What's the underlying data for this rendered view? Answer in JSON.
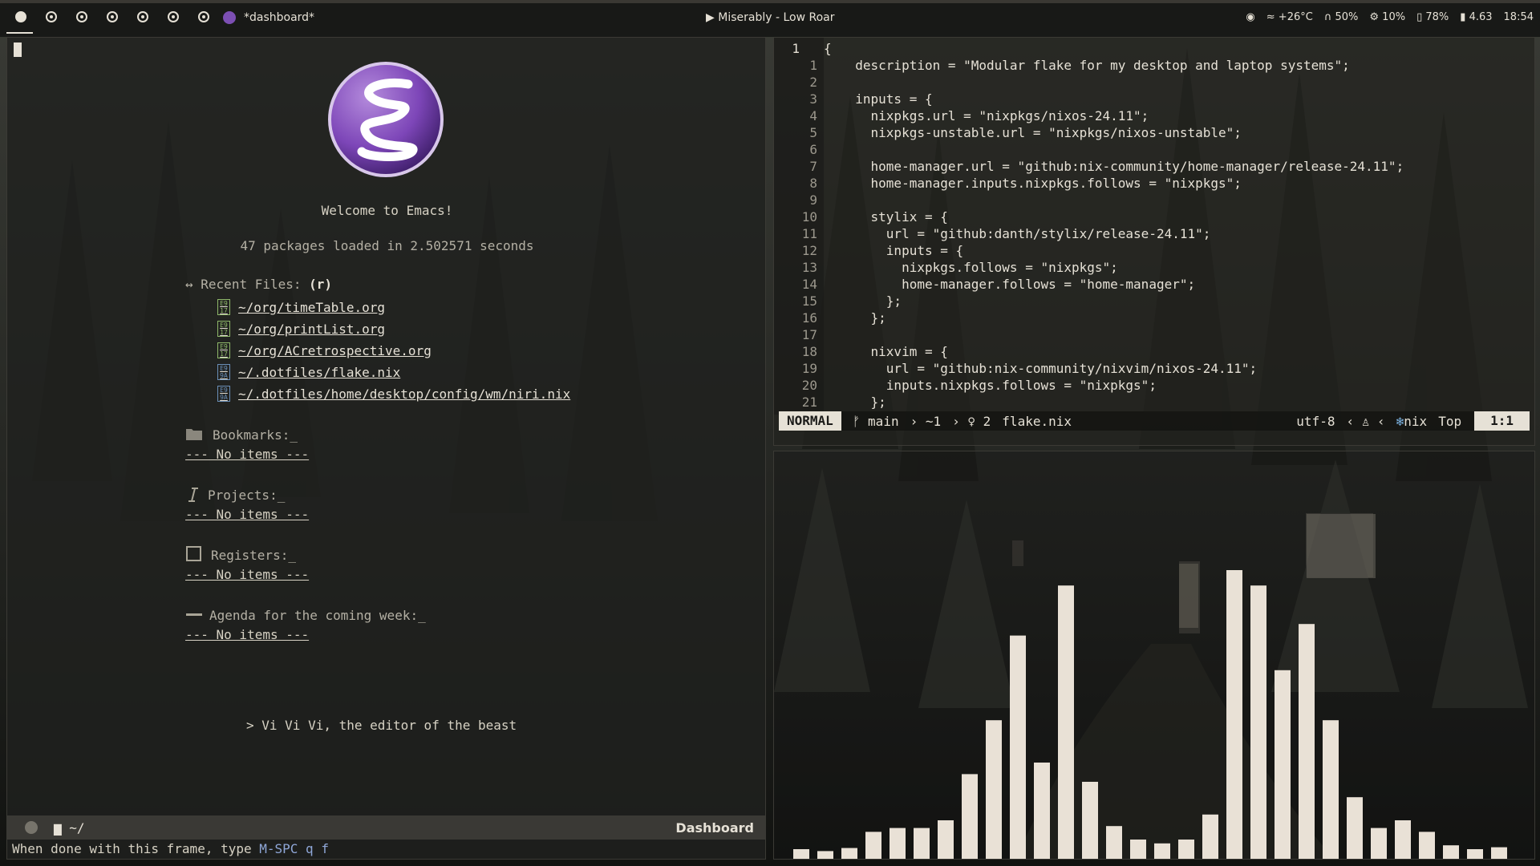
{
  "topbar": {
    "workspaces": [
      {
        "id": 1,
        "active": true
      },
      {
        "id": 2,
        "active": false
      },
      {
        "id": 3,
        "active": false
      },
      {
        "id": 4,
        "active": false
      },
      {
        "id": 5,
        "active": false
      },
      {
        "id": 6,
        "active": false
      },
      {
        "id": 7,
        "active": false
      }
    ],
    "window_title": "*dashboard*",
    "media_icon": "play-icon",
    "media_text": "Miserably - Low Roar",
    "status": {
      "steam_icon": "steam-icon",
      "temperature": "+26°C",
      "headphones": "50%",
      "cpu": "10%",
      "memory": "78%",
      "load": "4.63",
      "clock": "18:54"
    }
  },
  "dashboard": {
    "welcome": "Welcome to Emacs!",
    "packages": "47 packages loaded in 2.502571 seconds",
    "recent_files_label": "Recent Files:",
    "recent_files_key": "(r)",
    "recent_files": [
      {
        "icon_text": "E9\n17",
        "path": "~/org/timeTable.org"
      },
      {
        "icon_text": "E9\n17",
        "path": "~/org/printList.org"
      },
      {
        "icon_text": "E9\n17",
        "path": "~/org/ACretrospective.org"
      },
      {
        "icon_text": "E9\n9A",
        "path": "~/.dotfiles/flake.nix"
      },
      {
        "icon_text": "E9\n9A",
        "path": "~/.dotfiles/home/desktop/config/wm/niri.nix"
      }
    ],
    "bookmarks_label": "Bookmarks:_",
    "projects_label": "Projects:_",
    "registers_label": "Registers:_",
    "agenda_label": "Agenda for the coming week:_",
    "no_items": "--- No items ---",
    "quote": "> Vi Vi Vi, the editor of the beast",
    "modeline": {
      "dir": "~/",
      "buffer": "Dashboard"
    },
    "minibuffer_text": "When done with this frame, type ",
    "minibuffer_key": "M-SPC q f"
  },
  "editor": {
    "lines": [
      {
        "n": "1",
        "text": "{"
      },
      {
        "n": "1",
        "text": "  description = \"Modular flake for my desktop and laptop systems\";"
      },
      {
        "n": "2",
        "text": ""
      },
      {
        "n": "3",
        "text": "  inputs = {"
      },
      {
        "n": "4",
        "text": "    nixpkgs.url = \"nixpkgs/nixos-24.11\";"
      },
      {
        "n": "5",
        "text": "    nixpkgs-unstable.url = \"nixpkgs/nixos-unstable\";"
      },
      {
        "n": "6",
        "text": ""
      },
      {
        "n": "7",
        "text": "    home-manager.url = \"github:nix-community/home-manager/release-24.11\";"
      },
      {
        "n": "8",
        "text": "    home-manager.inputs.nixpkgs.follows = \"nixpkgs\";"
      },
      {
        "n": "9",
        "text": ""
      },
      {
        "n": "10",
        "text": "    stylix = {"
      },
      {
        "n": "11",
        "text": "      url = \"github:danth/stylix/release-24.11\";"
      },
      {
        "n": "12",
        "text": "      inputs = {"
      },
      {
        "n": "13",
        "text": "        nixpkgs.follows = \"nixpkgs\";"
      },
      {
        "n": "14",
        "text": "        home-manager.follows = \"home-manager\";"
      },
      {
        "n": "15",
        "text": "      };"
      },
      {
        "n": "16",
        "text": "    };"
      },
      {
        "n": "17",
        "text": ""
      },
      {
        "n": "18",
        "text": "    nixvim = {"
      },
      {
        "n": "19",
        "text": "      url = \"github:nix-community/nixvim/nixos-24.11\";"
      },
      {
        "n": "20",
        "text": "      inputs.nixpkgs.follows = \"nixpkgs\";"
      },
      {
        "n": "21",
        "text": "    };"
      }
    ],
    "statusline": {
      "mode": "NORMAL",
      "branch": "main",
      "changes": "~1",
      "diagnostics": "2",
      "filename": "flake.nix",
      "encoding": "utf-8",
      "filetype": "nix",
      "scroll": "Top",
      "position": "1:1"
    }
  },
  "visualizer": {
    "bar_color": "#e9e1d6",
    "levels": [
      0.025,
      0.02,
      0.028,
      0.07,
      0.08,
      0.08,
      0.1,
      0.22,
      0.36,
      0.58,
      0.25,
      0.71,
      0.2,
      0.085,
      0.05,
      0.04,
      0.05,
      0.115,
      0.75,
      0.71,
      0.49,
      0.61,
      0.36,
      0.16,
      0.08,
      0.1,
      0.07,
      0.035,
      0.025,
      0.03
    ]
  }
}
